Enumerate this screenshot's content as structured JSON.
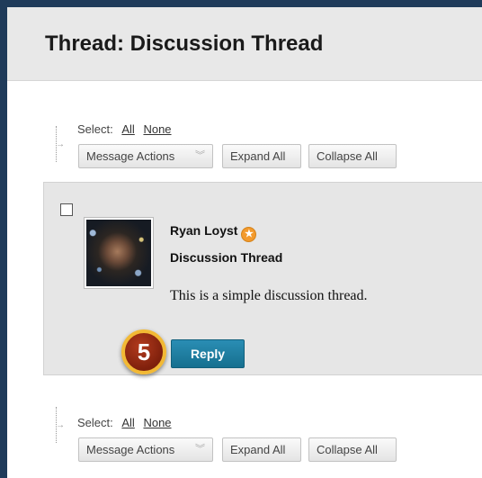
{
  "page": {
    "title": "Thread: Discussion Thread"
  },
  "toolbar": {
    "select_label": "Select:",
    "select_all": "All",
    "select_none": "None",
    "message_actions": "Message Actions",
    "expand_all": "Expand All",
    "collapse_all": "Collapse All"
  },
  "post": {
    "author": "Ryan Loyst",
    "author_badge_icon": "star-badge-icon",
    "subject": "Discussion Thread",
    "body": "This is a simple discussion thread.",
    "reply_label": "Reply",
    "step_number": "5"
  },
  "colors": {
    "header_bg": "#e8e8e8",
    "post_bg": "#e6e6e6",
    "reply_button": "#1d7fa3",
    "step_badge_ring": "#f2b935",
    "step_badge_fill": "#8e2a12",
    "frame_border": "#1f3b5a"
  }
}
